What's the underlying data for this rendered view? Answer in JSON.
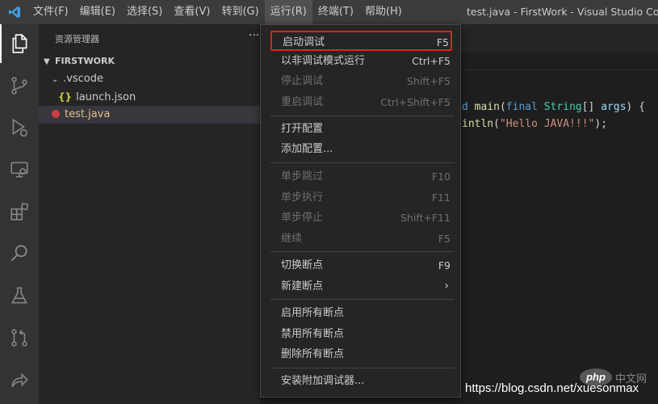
{
  "titlebar": {
    "menus": [
      "文件(F)",
      "编辑(E)",
      "选择(S)",
      "查看(V)",
      "转到(G)",
      "运行(R)",
      "终端(T)",
      "帮助(H)"
    ],
    "window_title": "test.java - FirstWork - Visual Studio Code"
  },
  "activitybar": {
    "icons": [
      "explorer-icon",
      "source-control-icon",
      "run-debug-icon",
      "remote-explorer-icon",
      "extensions-icon",
      "search-icon",
      "testing-icon",
      "pull-request-icon",
      "live-share-icon"
    ]
  },
  "sidebar": {
    "title": "资源管理器",
    "more": "···",
    "root_folder": "FIRSTWORK",
    "vscode_folder": ".vscode",
    "launch_file": "launch.json",
    "launch_icon": "{}",
    "java_file": "test.java"
  },
  "editor": {
    "line1": {
      "p1": "d ",
      "p2": "main",
      "p3": "(",
      "p4": "final",
      "p5": " ",
      "p6": "String",
      "p7": "[] ",
      "p8": "args",
      "p9": ") {"
    },
    "line2": {
      "p1": "intln",
      "p2": "(",
      "p3": "\"Hello JAVA!!!\"",
      "p4": ");"
    }
  },
  "run_menu": {
    "items": [
      {
        "label": "启动调试",
        "shortcut": "F5"
      },
      {
        "label": "以非调试模式运行",
        "shortcut": "Ctrl+F5"
      },
      {
        "label": "停止调试",
        "shortcut": "Shift+F5"
      },
      {
        "label": "重启调试",
        "shortcut": "Ctrl+Shift+F5"
      },
      {
        "label": "打开配置",
        "shortcut": ""
      },
      {
        "label": "添加配置...",
        "shortcut": ""
      },
      {
        "label": "单步跳过",
        "shortcut": "F10"
      },
      {
        "label": "单步执行",
        "shortcut": "F11"
      },
      {
        "label": "单步停止",
        "shortcut": "Shift+F11"
      },
      {
        "label": "继续",
        "shortcut": "F5"
      },
      {
        "label": "切换断点",
        "shortcut": "F9"
      },
      {
        "label": "新建断点",
        "shortcut": ""
      },
      {
        "label": "启用所有断点",
        "shortcut": ""
      },
      {
        "label": "禁用所有断点",
        "shortcut": ""
      },
      {
        "label": "删除所有断点",
        "shortcut": ""
      },
      {
        "label": "安装附加调试器...",
        "shortcut": ""
      }
    ],
    "submenu_arrow": "›"
  },
  "watermark": {
    "url": "https://blog.csdn.net/xuesonmax",
    "php_logo": "php",
    "php_cn": "中文网"
  },
  "colors": {
    "highlight_border": "#e3231b",
    "java_file_color": "#e2c08d",
    "titlebar_bg": "#3c3c3c"
  }
}
